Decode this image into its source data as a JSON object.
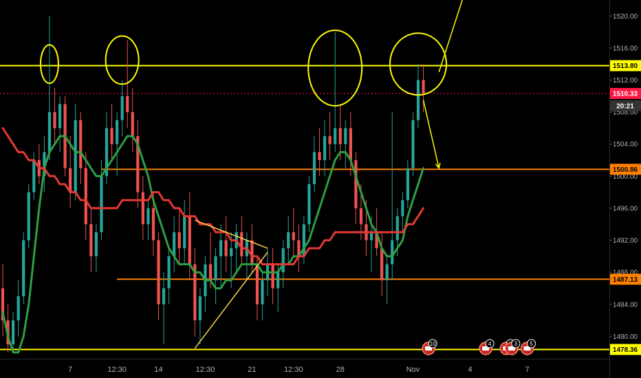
{
  "chart_data": {
    "type": "line",
    "title": "",
    "xlabel": "",
    "ylabel": "",
    "ylim": [
      1477.2,
      1522.0
    ],
    "y_ticks": [
      "1520.00",
      "1516.00",
      "1512.00",
      "1508.00",
      "1504.00",
      "1500.00",
      "1496.00",
      "1492.00",
      "1488.00",
      "1484.00",
      "1480.00"
    ],
    "x_ticks": [
      {
        "label": "7",
        "i": 13
      },
      {
        "label": "12:30",
        "i": 22
      },
      {
        "label": "14",
        "i": 30
      },
      {
        "label": "12:30",
        "i": 39
      },
      {
        "label": "21",
        "i": 48
      },
      {
        "label": "12:30",
        "i": 56
      },
      {
        "label": "28",
        "i": 65
      },
      {
        "label": "Nov",
        "i": 79
      },
      {
        "label": "4",
        "i": 90
      },
      {
        "label": "7",
        "i": 101
      }
    ],
    "x_count": 112,
    "price_labels": [
      {
        "text": "1513.80",
        "value": 1513.8,
        "color": "#ffff00",
        "text_color": "#000000"
      },
      {
        "text": "1510.33",
        "value": 1510.33,
        "color": "#ff1744",
        "text_color": "#ffffff"
      },
      {
        "text": "20:21",
        "value": 1508.8,
        "color": "#333333",
        "text_color": "#ffffff"
      },
      {
        "text": "1500.86",
        "value": 1500.86,
        "color": "#ff8000",
        "text_color": "#000000"
      },
      {
        "text": "1487.13",
        "value": 1487.13,
        "color": "#ff8000",
        "text_color": "#000000"
      },
      {
        "text": "1478.36",
        "value": 1478.36,
        "color": "#ffff00",
        "text_color": "#000000"
      }
    ],
    "horizontal_lines": [
      {
        "value": 1513.8,
        "color": "#ffff00",
        "style": "solid"
      },
      {
        "value": 1510.33,
        "color": "#ff1744",
        "style": "dotted"
      },
      {
        "value": 1500.86,
        "color": "#ff8000",
        "style": "solid",
        "i_start": 19
      },
      {
        "value": 1487.13,
        "color": "#ff8000",
        "style": "solid",
        "i_start": 22
      },
      {
        "value": 1478.36,
        "color": "#ffff00",
        "style": "solid"
      }
    ],
    "candles": [
      [
        1486,
        1489,
        1480,
        1482
      ],
      [
        1482,
        1484,
        1478,
        1479
      ],
      [
        1479,
        1483,
        1478,
        1482
      ],
      [
        1482,
        1487,
        1480,
        1485
      ],
      [
        1485,
        1493,
        1484,
        1492
      ],
      [
        1492,
        1499,
        1491,
        1498
      ],
      [
        1498,
        1503,
        1497,
        1502
      ],
      [
        1502,
        1504,
        1499,
        1500
      ],
      [
        1500,
        1505,
        1498,
        1503
      ],
      [
        1503,
        1520,
        1502,
        1508
      ],
      [
        1508,
        1511,
        1504,
        1506
      ],
      [
        1506,
        1510,
        1503,
        1509
      ],
      [
        1509,
        1510,
        1500,
        1501
      ],
      [
        1501,
        1505,
        1496,
        1498
      ],
      [
        1498,
        1509,
        1497,
        1507
      ],
      [
        1507,
        1508,
        1499,
        1501
      ],
      [
        1501,
        1503,
        1492,
        1494
      ],
      [
        1494,
        1496,
        1488,
        1490
      ],
      [
        1490,
        1494,
        1488,
        1493
      ],
      [
        1493,
        1502,
        1492,
        1500
      ],
      [
        1500,
        1508,
        1499,
        1506
      ],
      [
        1506,
        1509,
        1502,
        1504
      ],
      [
        1504,
        1508,
        1500,
        1507
      ],
      [
        1507,
        1512,
        1505,
        1510
      ],
      [
        1510,
        1517,
        1506,
        1508
      ],
      [
        1508,
        1511,
        1503,
        1505
      ],
      [
        1505,
        1507,
        1496,
        1498
      ],
      [
        1498,
        1500,
        1492,
        1494
      ],
      [
        1494,
        1497,
        1492,
        1496
      ],
      [
        1496,
        1498,
        1490,
        1492
      ],
      [
        1492,
        1493,
        1482,
        1484
      ],
      [
        1484,
        1488,
        1479,
        1486
      ],
      [
        1486,
        1491,
        1484,
        1490
      ],
      [
        1490,
        1495,
        1488,
        1493
      ],
      [
        1493,
        1496,
        1489,
        1491
      ],
      [
        1491,
        1497,
        1489,
        1495
      ],
      [
        1495,
        1498,
        1487,
        1489
      ],
      [
        1489,
        1491,
        1480,
        1482
      ],
      [
        1482,
        1486,
        1479,
        1485
      ],
      [
        1485,
        1490,
        1483,
        1489
      ],
      [
        1489,
        1493,
        1486,
        1487
      ],
      [
        1487,
        1491,
        1484,
        1490
      ],
      [
        1490,
        1494,
        1486,
        1492
      ],
      [
        1492,
        1495,
        1488,
        1490
      ],
      [
        1490,
        1493,
        1486,
        1491
      ],
      [
        1491,
        1494,
        1488,
        1493
      ],
      [
        1493,
        1495,
        1489,
        1490
      ],
      [
        1490,
        1493,
        1487,
        1492
      ],
      [
        1492,
        1494,
        1488,
        1489
      ],
      [
        1489,
        1490,
        1482,
        1484
      ],
      [
        1484,
        1488,
        1482,
        1487
      ],
      [
        1487,
        1491,
        1485,
        1489
      ],
      [
        1489,
        1491,
        1484,
        1486
      ],
      [
        1486,
        1489,
        1483,
        1488
      ],
      [
        1488,
        1492,
        1486,
        1491
      ],
      [
        1491,
        1495,
        1489,
        1493
      ],
      [
        1493,
        1496,
        1490,
        1492
      ],
      [
        1492,
        1494,
        1488,
        1490
      ],
      [
        1490,
        1495,
        1489,
        1494
      ],
      [
        1494,
        1500,
        1493,
        1499
      ],
      [
        1499,
        1505,
        1498,
        1503
      ],
      [
        1503,
        1506,
        1500,
        1502
      ],
      [
        1502,
        1507,
        1500,
        1505
      ],
      [
        1505,
        1508,
        1502,
        1504
      ],
      [
        1504,
        1518,
        1503,
        1506
      ],
      [
        1506,
        1509,
        1502,
        1504
      ],
      [
        1504,
        1507,
        1501,
        1506
      ],
      [
        1506,
        1508,
        1500,
        1502
      ],
      [
        1502,
        1503,
        1494,
        1496
      ],
      [
        1496,
        1499,
        1492,
        1494
      ],
      [
        1494,
        1497,
        1490,
        1492
      ],
      [
        1492,
        1495,
        1488,
        1493
      ],
      [
        1493,
        1496,
        1490,
        1491
      ],
      [
        1491,
        1493,
        1485,
        1487
      ],
      [
        1487,
        1490,
        1484,
        1489
      ],
      [
        1489,
        1508,
        1487,
        1492
      ],
      [
        1492,
        1496,
        1490,
        1495
      ],
      [
        1495,
        1498,
        1493,
        1497
      ],
      [
        1497,
        1502,
        1496,
        1501
      ],
      [
        1501,
        1508,
        1500,
        1507
      ],
      [
        1507,
        1514,
        1506,
        1512
      ],
      [
        1512,
        1514,
        1508,
        1510.33
      ]
    ],
    "series": [
      {
        "name": "",
        "color": "#2ea043",
        "start": 0,
        "values": [
          1483,
          1480,
          1478,
          1478,
          1480,
          1484,
          1490,
          1496,
          1501,
          1503,
          1504,
          1505,
          1505,
          1504,
          1503,
          1503,
          1502,
          1501,
          1500,
          1500,
          1501,
          1502,
          1503,
          1504,
          1505,
          1505,
          1504,
          1502,
          1500,
          1497,
          1495,
          1493,
          1491,
          1490,
          1489,
          1489,
          1489,
          1488,
          1488,
          1487,
          1487,
          1486,
          1486,
          1487,
          1487,
          1488,
          1489,
          1489,
          1489,
          1489,
          1488,
          1488,
          1488,
          1488,
          1489,
          1489,
          1490,
          1490,
          1491,
          1492,
          1494,
          1496,
          1498,
          1500,
          1502,
          1503,
          1503,
          1502,
          1500,
          1498,
          1496,
          1494,
          1493,
          1491,
          1490,
          1490,
          1491,
          1492,
          1495,
          1497,
          1499,
          1501
        ]
      },
      {
        "name": "",
        "color": "#e53935",
        "start": 0,
        "values": [
          1506,
          1505,
          1504,
          1503,
          1503,
          1502,
          1502,
          1501,
          1501,
          1500,
          1500,
          1499,
          1499,
          1498,
          1498,
          1497,
          1497,
          1496,
          1496,
          1496,
          1496,
          1496,
          1496,
          1497,
          1497,
          1497,
          1497,
          1497,
          1497,
          1498,
          1498,
          1497,
          1497,
          1496,
          1496,
          1495,
          1495,
          1495,
          1494,
          1494,
          1494,
          1493,
          1493,
          1493,
          1492,
          1492,
          1491,
          1491,
          1490,
          1490,
          1489,
          1489,
          1489,
          1489,
          1489,
          1489,
          1489,
          1490,
          1490,
          1491,
          1491,
          1491,
          1492,
          1492,
          1493,
          1493,
          1493,
          1493,
          1493,
          1493,
          1493,
          1493,
          1493,
          1493,
          1493,
          1493,
          1493,
          1493,
          1494,
          1494,
          1495,
          1496
        ]
      }
    ],
    "annotations": {
      "circles": [
        {
          "ci": 9,
          "cv": 1514.0,
          "w": 26,
          "h": 56
        },
        {
          "ci": 23,
          "cv": 1514.5,
          "w": 48,
          "h": 70
        },
        {
          "ci": 64,
          "cv": 1513.5,
          "w": 78,
          "h": 110
        },
        {
          "ci": 80,
          "cv": 1514.0,
          "w": 82,
          "h": 90
        }
      ],
      "lines": [
        {
          "i1": 37,
          "v1": 1494.5,
          "i2": 51,
          "v2": 1491.0,
          "color": "#ffd54f"
        },
        {
          "i1": 37,
          "v1": 1478.5,
          "i2": 51,
          "v2": 1490.5,
          "color": "#ffd54f"
        },
        {
          "i1": 84,
          "v1": 1513.0,
          "i2": 92,
          "v2": 1529.0,
          "color": "#ffff00"
        }
      ],
      "arrows": [
        {
          "i1": 81,
          "v1": 1509.5,
          "i2": 84,
          "v2": 1501.0,
          "color": "#ffff00"
        }
      ]
    },
    "event_badges": [
      {
        "text": "10",
        "i": 82
      },
      {
        "text": "4",
        "i": 93
      },
      {
        "text": "4",
        "i": 97
      },
      {
        "text": "3",
        "i": 98
      },
      {
        "text": "5",
        "i": 101
      }
    ]
  }
}
